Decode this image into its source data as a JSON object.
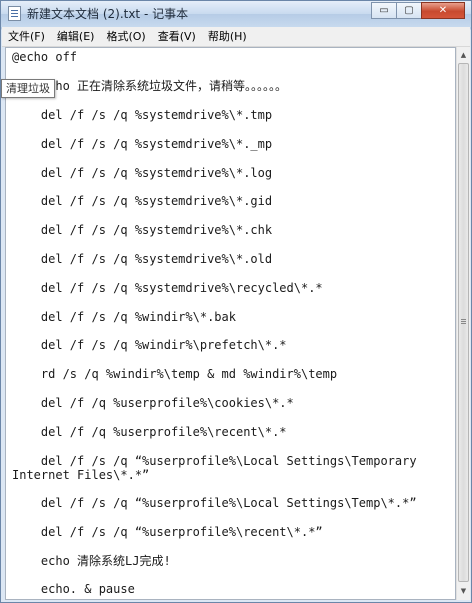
{
  "window": {
    "title": "新建文本文档 (2).txt - 记事本",
    "minimize": "▭",
    "maximize": "▢",
    "close": "✕"
  },
  "menu": [
    {
      "label": "文件(F)"
    },
    {
      "label": "编辑(E)"
    },
    {
      "label": "格式(O)"
    },
    {
      "label": "查看(V)"
    },
    {
      "label": "帮助(H)"
    }
  ],
  "tooltip": "清理垃圾",
  "lines": [
    "@echo off",
    "    echo 正在清除系统垃圾文件，请稍等。。。。。。",
    "    del /f /s /q %systemdrive%\\*.tmp",
    "    del /f /s /q %systemdrive%\\*._mp",
    "    del /f /s /q %systemdrive%\\*.log",
    "    del /f /s /q %systemdrive%\\*.gid",
    "    del /f /s /q %systemdrive%\\*.chk",
    "    del /f /s /q %systemdrive%\\*.old",
    "    del /f /s /q %systemdrive%\\recycled\\*.*",
    "    del /f /s /q %windir%\\*.bak",
    "    del /f /s /q %windir%\\prefetch\\*.*",
    "    rd /s /q %windir%\\temp & md %windir%\\temp",
    "    del /f /q %userprofile%\\cookies\\*.*",
    "    del /f /q %userprofile%\\recent\\*.*",
    "    del /f /s /q “%userprofile%\\Local Settings\\Temporary",
    "Internet Files\\*.*”",
    "    del /f /s /q “%userprofile%\\Local Settings\\Temp\\*.*”",
    "    del /f /s /q “%userprofile%\\recent\\*.*”",
    "    echo 清除系统LJ完成!",
    "    echo. & pause"
  ],
  "scrollbar": {
    "up": "▲",
    "down": "▼"
  }
}
